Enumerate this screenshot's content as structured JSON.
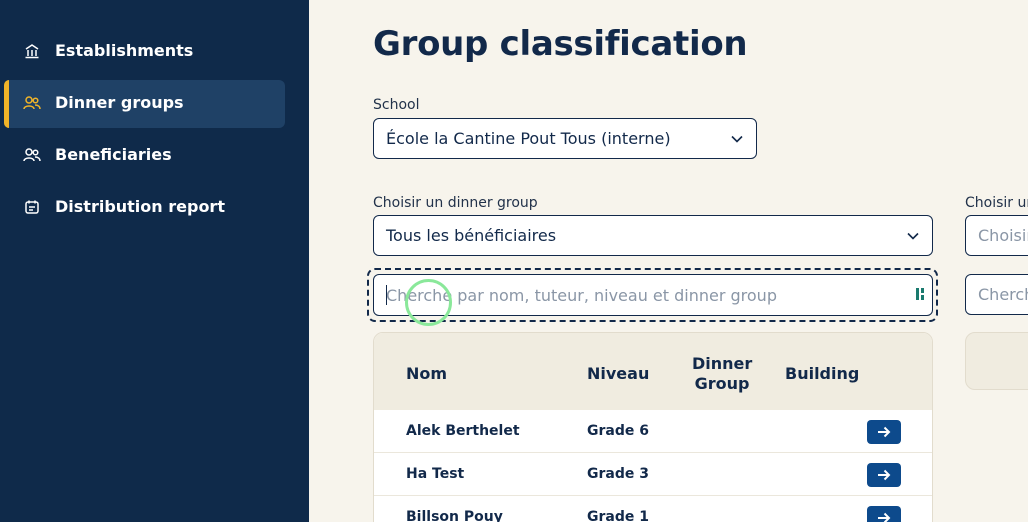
{
  "sidebar": {
    "items": [
      {
        "label": "Establishments",
        "icon": "building-icon",
        "active": false
      },
      {
        "label": "Dinner groups",
        "icon": "users-icon",
        "active": true
      },
      {
        "label": "Beneficiaries",
        "icon": "user-group-icon",
        "active": false
      },
      {
        "label": "Distribution report",
        "icon": "calendar-icon",
        "active": false
      }
    ]
  },
  "main": {
    "title": "Group classification",
    "school": {
      "label": "School",
      "value": "École la Cantine Pout Tous (interne)"
    },
    "left_panel": {
      "group_select": {
        "label": "Choisir un dinner group",
        "value": "Tous les bénéficiaires"
      },
      "search": {
        "placeholder": "Cherche par nom, tuteur, niveau et dinner group"
      },
      "table": {
        "columns": [
          "Nom",
          "Niveau",
          "Dinner Group",
          "Building"
        ],
        "rows": [
          {
            "nom": "Alek Berthelet",
            "niveau": "Grade 6",
            "dinner_group": "",
            "building": ""
          },
          {
            "nom": "Ha Test",
            "niveau": "Grade 3",
            "dinner_group": "",
            "building": ""
          },
          {
            "nom": "Billson Pouy",
            "niveau": "Grade 1",
            "dinner_group": "",
            "building": ""
          }
        ]
      }
    },
    "right_panel": {
      "group_select": {
        "label": "Choisir un",
        "placeholder": "Choisir"
      },
      "search": {
        "placeholder": "Cherch"
      }
    }
  },
  "colors": {
    "sidebar_bg": "#0f2a4a",
    "active_item_bg": "#1f4166",
    "accent": "#f0b429",
    "page_bg": "#f7f4ec",
    "primary_button": "#0d4a8c"
  }
}
